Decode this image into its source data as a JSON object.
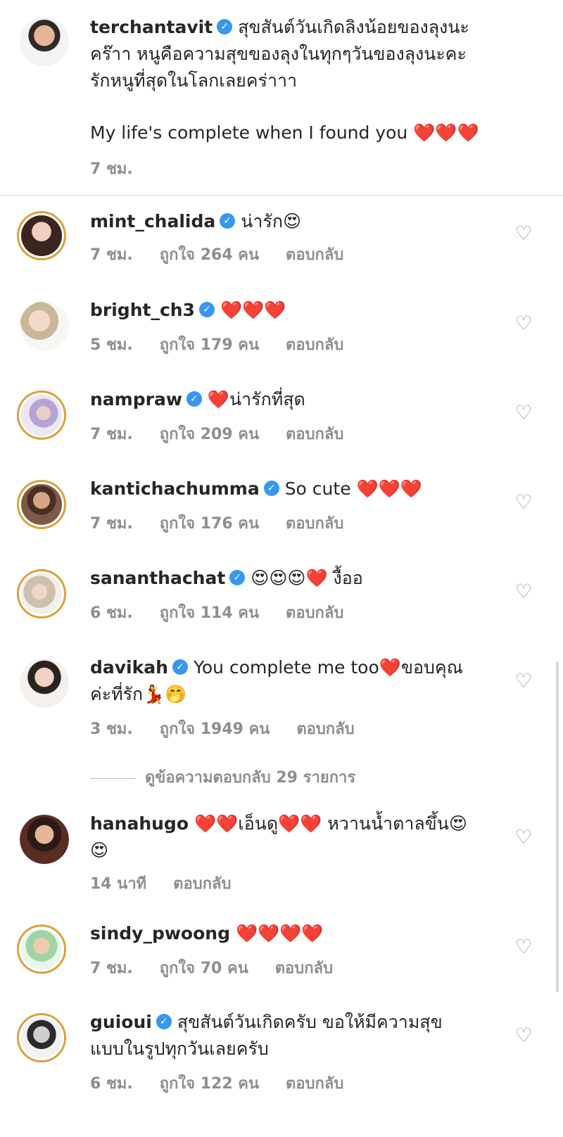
{
  "caption": {
    "username": "terchantavit",
    "text_line1": "สุขสันต์วันเกิดลิงน้อยของลุงนะ",
    "text_line2": "คร๊าา หนูคือความสุขของลุงในทุกๆวันของลุงนะคะ",
    "text_line3": "รักหนูที่สุดในโลกเลยคร่าาา",
    "text_line4": "My life's complete when I found you ❤️❤️❤️",
    "time": "7 ชม.",
    "verified": true
  },
  "comments": [
    {
      "username": "mint_chalida",
      "verified": true,
      "text": "น่ารัก😍",
      "time": "7 ชม.",
      "likes": "ถูกใจ 264 คน",
      "reply": "ตอบกลับ"
    },
    {
      "username": "bright_ch3",
      "verified": true,
      "text": "❤️❤️❤️",
      "time": "5 ชม.",
      "likes": "ถูกใจ 179 คน",
      "reply": "ตอบกลับ"
    },
    {
      "username": "nampraw",
      "verified": true,
      "text": "❤️น่ารักที่สุด",
      "time": "7 ชม.",
      "likes": "ถูกใจ 209 คน",
      "reply": "ตอบกลับ"
    },
    {
      "username": "kantichachumma",
      "verified": true,
      "text": "So cute ❤️❤️❤️",
      "time": "7 ชม.",
      "likes": "ถูกใจ 176 คน",
      "reply": "ตอบกลับ"
    },
    {
      "username": "sananthachat",
      "verified": true,
      "text": "😍😍😍❤️ งื้ออ",
      "time": "6 ชม.",
      "likes": "ถูกใจ 114 คน",
      "reply": "ตอบกลับ"
    },
    {
      "username": "davikah",
      "verified": true,
      "text": "You complete me too❤️ขอบคุณ",
      "text_line2": "ค่ะที่รัก💃🤭",
      "time": "3 ชม.",
      "likes": "ถูกใจ 1949 คน",
      "reply": "ตอบกลับ"
    },
    {
      "username": "hanahugo",
      "verified": false,
      "text": "❤️❤️เอ็นดู❤️❤️ หวานน้ำตาลขึ้น😍",
      "text_line2": "😍",
      "time": "14 นาที",
      "reply": "ตอบกลับ"
    },
    {
      "username": "sindy_pwoong",
      "verified": false,
      "text": "❤️❤️❤️❤️",
      "time": "7 ชม.",
      "likes": "ถูกใจ 70 คน",
      "reply": "ตอบกลับ"
    },
    {
      "username": "guioui",
      "verified": true,
      "text": "สุขสันต์วันเกิดครับ ขอให้มีความสุข",
      "text_line2": "แบบในรูปทุกวันเลยครับ",
      "time": "6 ชม.",
      "likes": "ถูกใจ 122 คน",
      "reply": "ตอบกลับ"
    }
  ],
  "view_replies": "ดูข้อความตอบกลับ 29 รายการ",
  "icons": {
    "verified": "verified-badge-icon",
    "like": "heart-outline-icon"
  },
  "colors": {
    "verified": "#3897f0",
    "story_ring": "#d9a23d",
    "muted": "#8e8e8e",
    "heart": "#ed1c3a"
  }
}
